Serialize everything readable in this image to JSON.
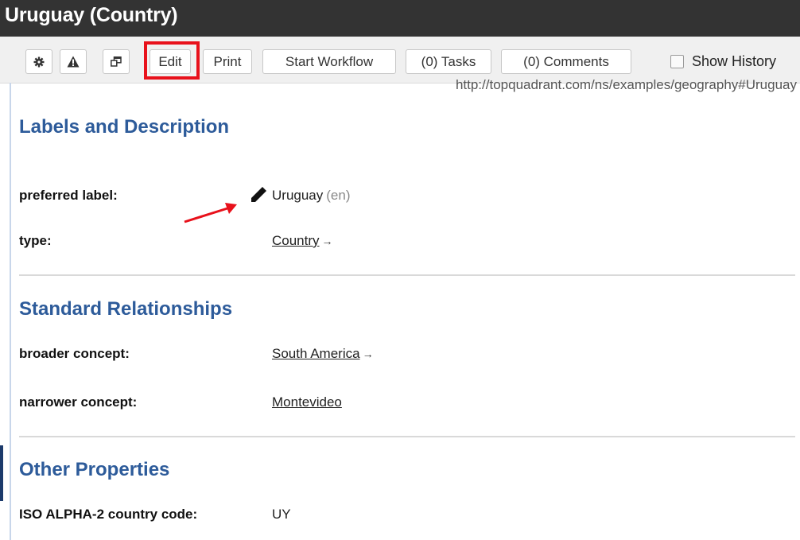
{
  "window": {
    "title": "Uruguay (Country)"
  },
  "toolbar": {
    "settings_icon": "gear-icon",
    "warning_icon": "warning-icon",
    "popout_icon": "popout-icon",
    "edit_label": "Edit",
    "print_label": "Print",
    "workflow_label": "Start Workflow",
    "tasks_label": "(0) Tasks",
    "comments_label": "(0) Comments",
    "history_label": "Show History",
    "history_checked": false
  },
  "resource": {
    "uri": "http://topquadrant.com/ns/examples/geography#Uruguay"
  },
  "sections": {
    "labels": {
      "heading": "Labels and Description",
      "preferred_label": {
        "label": "preferred label:",
        "value": "Uruguay",
        "lang": "(en)"
      },
      "type": {
        "label": "type:",
        "value": "Country",
        "arrow": "→"
      }
    },
    "relationships": {
      "heading": "Standard Relationships",
      "broader": {
        "label": "broader concept:",
        "value": "South America",
        "arrow": "→"
      },
      "narrower": {
        "label": "narrower concept:",
        "value": "Montevideo"
      }
    },
    "other": {
      "heading": "Other Properties",
      "iso": {
        "label": "ISO ALPHA-2 country code:",
        "value": "UY"
      }
    }
  },
  "colors": {
    "titlebar_bg": "#333333",
    "heading": "#2d5b9a",
    "highlight": "#e8111b",
    "annotation_arrow": "#e8111b"
  }
}
